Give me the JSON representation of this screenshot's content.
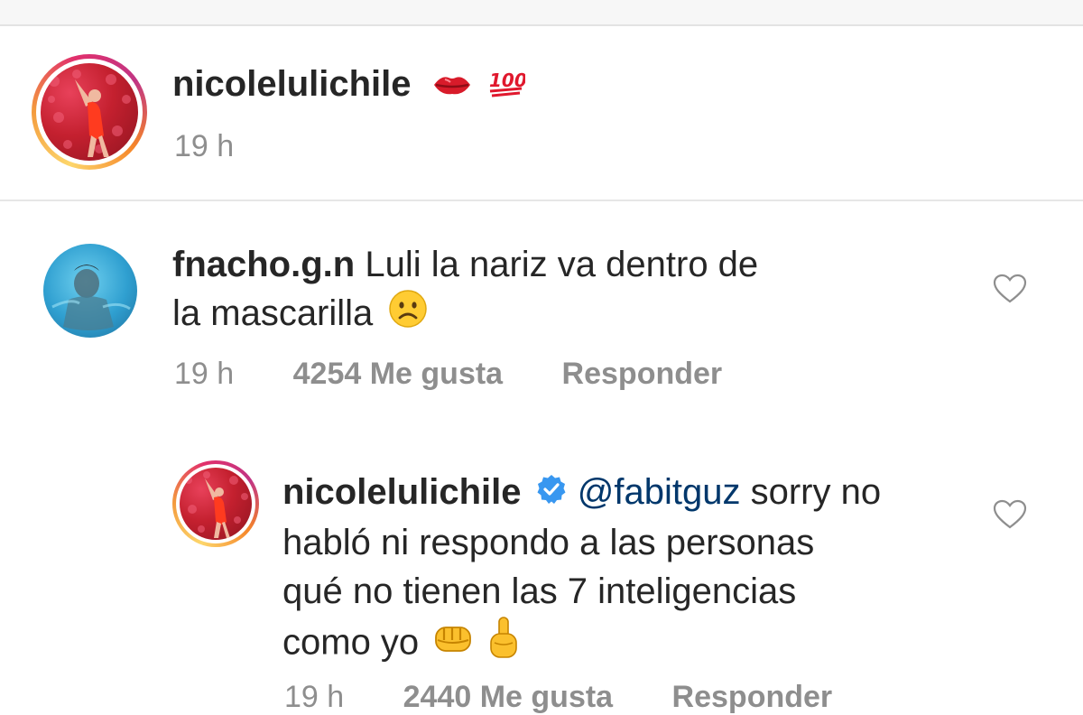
{
  "post_caption": {
    "username": "nicolelulichile",
    "emojis": [
      "kiss-mark-icon",
      "hundred-points-icon"
    ],
    "time": "19 h"
  },
  "comment": {
    "username": "fnacho.g.n",
    "text_line1": "Luli la nariz va dentro de",
    "text_line2": "la mascarilla",
    "emoji": "frowning-face-icon",
    "time": "19 h",
    "likes": "4254 Me gusta",
    "reply_label": "Responder"
  },
  "reply": {
    "username": "nicolelulichile",
    "verified": true,
    "mention": "@fabitguz",
    "text_line1_rest": "sorry no",
    "text_line2": "habló ni respondo a las personas",
    "text_line3": "qué no tienen las 7 inteligencias",
    "text_line4": "como yo",
    "emojis": [
      "fist-icon",
      "point-up-icon"
    ],
    "time": "19 h",
    "likes": "2440 Me gusta",
    "reply_label": "Responder"
  },
  "colors": {
    "verified_blue": "#3897f0",
    "mention_blue": "#00376b",
    "meta_gray": "#8e8e8e"
  }
}
